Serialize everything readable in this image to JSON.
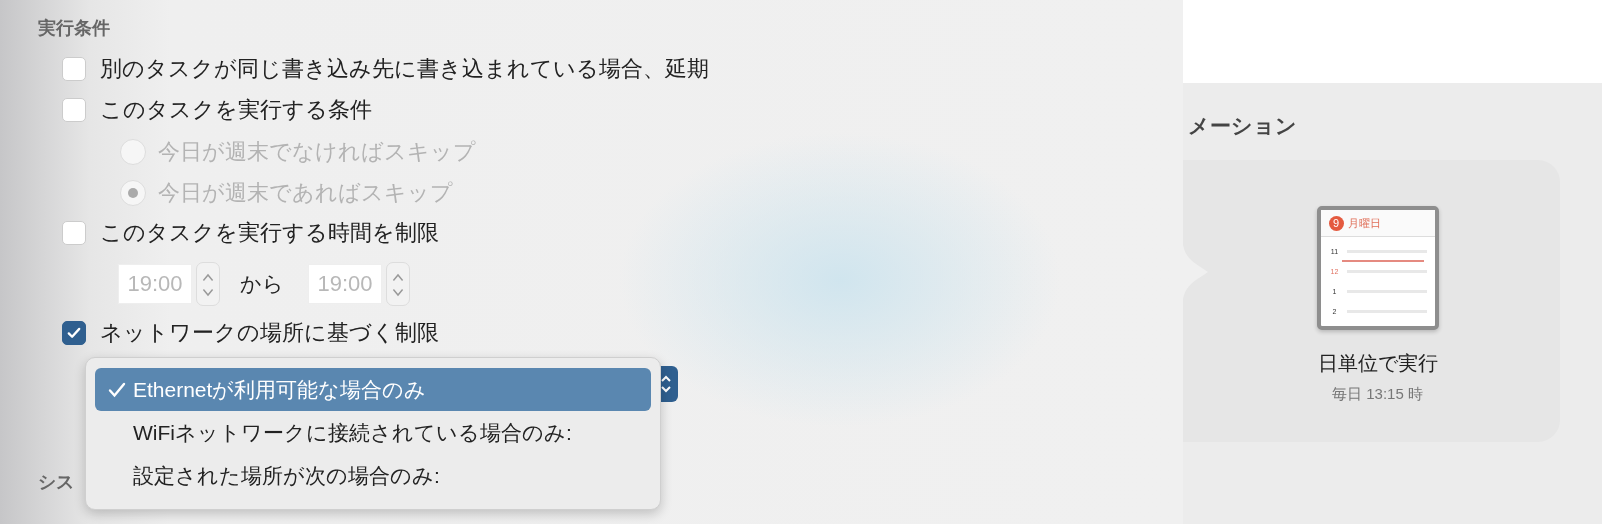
{
  "panel": {
    "section_title": "実行条件",
    "options": [
      {
        "kind": "checkbox",
        "label": "別のタスクが同じ書き込み先に書き込まれている場合、延期",
        "checked": false,
        "disabled": false
      },
      {
        "kind": "checkbox",
        "label": "このタスクを実行する条件",
        "checked": false,
        "disabled": false
      },
      {
        "kind": "radio",
        "label": "今日が週末でなければスキップ",
        "selected": false,
        "disabled": true
      },
      {
        "kind": "radio",
        "label": "今日が週末であればスキップ",
        "selected": true,
        "disabled": true
      },
      {
        "kind": "checkbox",
        "label": "このタスクを実行する時間を制限",
        "checked": false,
        "disabled": false
      },
      {
        "kind": "time_range",
        "from": "19:00",
        "separator": "から",
        "to": "19:00",
        "disabled": true
      },
      {
        "kind": "checkbox",
        "label": "ネットワークの場所に基づく制限",
        "checked": true,
        "disabled": false
      }
    ],
    "next_section_title": "シス",
    "network_menu": [
      {
        "label": "Ethernetが利用可能な場合のみ",
        "selected": true
      },
      {
        "label": "WiFiネットワークに接続されている場合のみ:",
        "selected": false
      },
      {
        "label": "設定された場所が次の場合のみ:",
        "selected": false
      }
    ]
  },
  "automation": {
    "section_title": "メーション",
    "card": {
      "day_number": "9",
      "day_name": "月曜日",
      "hours": [
        "11",
        "12",
        "1",
        "2"
      ],
      "title": "日単位で実行",
      "subtitle": "毎日 13:15 時"
    }
  }
}
